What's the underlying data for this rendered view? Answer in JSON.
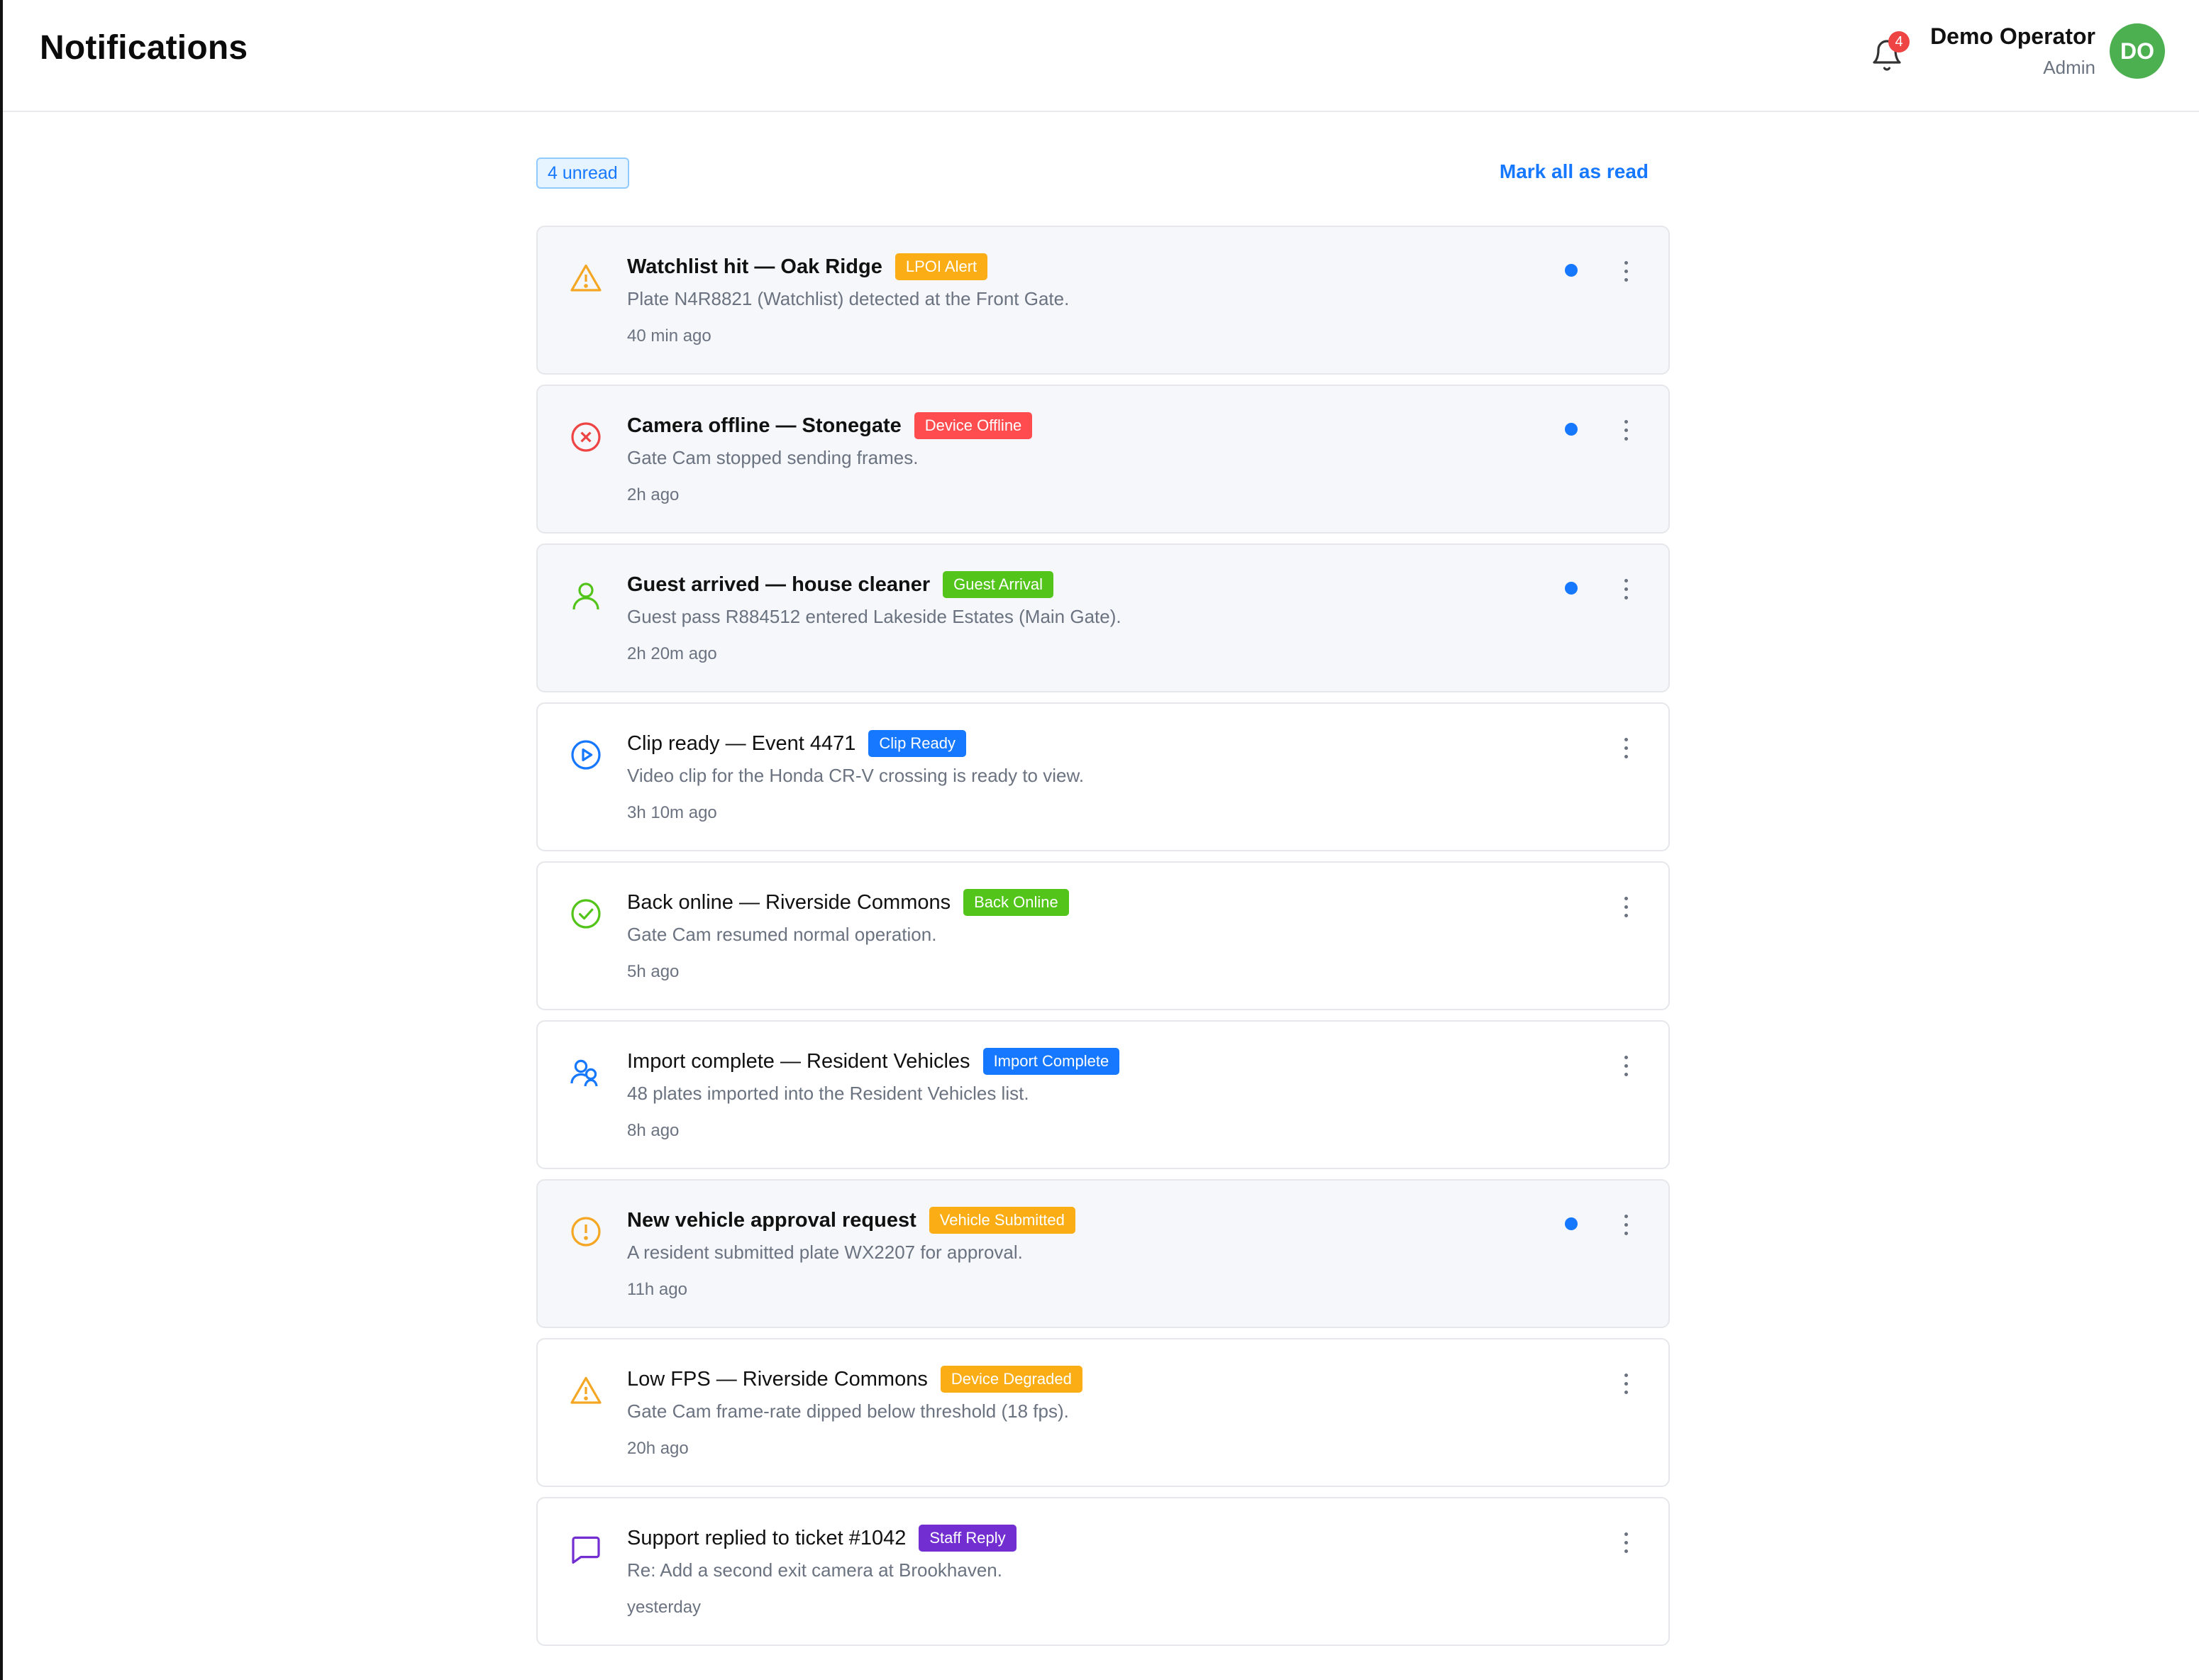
{
  "header": {
    "title": "Notifications",
    "bell_icon": "bell-icon",
    "bell_badge": "4",
    "user_name": "Demo Operator",
    "user_role": "Admin",
    "avatar_initials": "DO"
  },
  "toolbar": {
    "unread_label": "4 unread",
    "mark_all_label": "Mark all as read"
  },
  "colors": {
    "accent": "#1677ff",
    "unread_dot": "#1677ff",
    "avatar_bg": "#4caf50",
    "badge_bg": "#ef4444"
  },
  "notifications": [
    {
      "title": "Watchlist hit — Oak Ridge",
      "tag": "LPOI Alert",
      "tag_color": "#faad14",
      "description": "Plate N4R8821 (Watchlist) detected at the Front Gate.",
      "time": "40 min ago",
      "unread": true,
      "icon": "warning-triangle-icon",
      "icon_color": "#f5a623"
    },
    {
      "title": "Camera offline — Stonegate",
      "tag": "Device Offline",
      "tag_color": "#ff4d4f",
      "description": "Gate Cam stopped sending frames.",
      "time": "2h ago",
      "unread": true,
      "icon": "circle-x-icon",
      "icon_color": "#ef4444"
    },
    {
      "title": "Guest arrived — house cleaner",
      "tag": "Guest Arrival",
      "tag_color": "#52c41a",
      "description": "Guest pass R884512 entered Lakeside Estates (Main Gate).",
      "time": "2h 20m ago",
      "unread": true,
      "icon": "user-icon",
      "icon_color": "#52c41a"
    },
    {
      "title": "Clip ready — Event 4471",
      "tag": "Clip Ready",
      "tag_color": "#1677ff",
      "description": "Video clip for the Honda CR-V crossing is ready to view.",
      "time": "3h 10m ago",
      "unread": false,
      "icon": "play-circle-icon",
      "icon_color": "#1677ff"
    },
    {
      "title": "Back online — Riverside Commons",
      "tag": "Back Online",
      "tag_color": "#52c41a",
      "description": "Gate Cam resumed normal operation.",
      "time": "5h ago",
      "unread": false,
      "icon": "check-circle-icon",
      "icon_color": "#52c41a"
    },
    {
      "title": "Import complete — Resident Vehicles",
      "tag": "Import Complete",
      "tag_color": "#1677ff",
      "description": "48 plates imported into the Resident Vehicles list.",
      "time": "8h ago",
      "unread": false,
      "icon": "users-icon",
      "icon_color": "#1677ff"
    },
    {
      "title": "New vehicle approval request",
      "tag": "Vehicle Submitted",
      "tag_color": "#faad14",
      "description": "A resident submitted plate WX2207 for approval.",
      "time": "11h ago",
      "unread": true,
      "icon": "exclamation-circle-icon",
      "icon_color": "#f5a623"
    },
    {
      "title": "Low FPS — Riverside Commons",
      "tag": "Device Degraded",
      "tag_color": "#faad14",
      "description": "Gate Cam frame-rate dipped below threshold (18 fps).",
      "time": "20h ago",
      "unread": false,
      "icon": "warning-triangle-icon",
      "icon_color": "#f5a623"
    },
    {
      "title": "Support replied to ticket #1042",
      "tag": "Staff Reply",
      "tag_color": "#722ed1",
      "description": "Re: Add a second exit camera at Brookhaven.",
      "time": "yesterday",
      "unread": false,
      "icon": "message-icon",
      "icon_color": "#722ed1"
    }
  ]
}
